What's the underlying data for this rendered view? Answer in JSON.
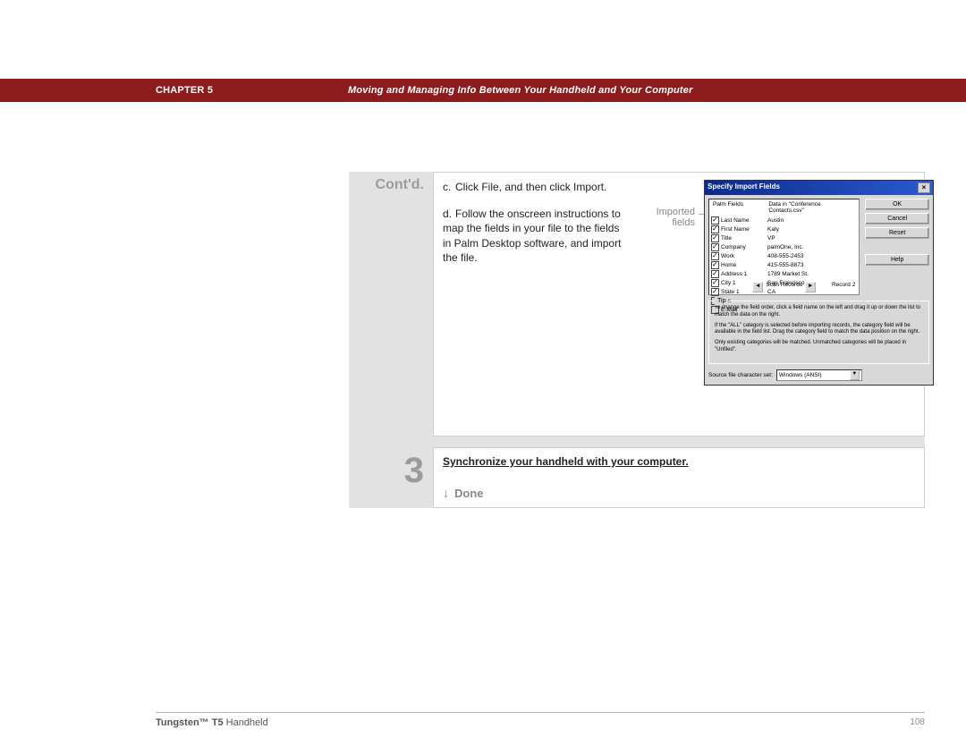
{
  "banner": {
    "chapter": "CHAPTER 5",
    "title": "Moving and Managing Info Between Your Handheld and Your Computer"
  },
  "contd_label": "Cont'd.",
  "steps": {
    "c": {
      "letter": "c.",
      "text": "Click File, and then click Import."
    },
    "d": {
      "letter": "d.",
      "text": "Follow the onscreen instructions to map the fields in your file to the fields in Palm Desktop software, and import the file."
    }
  },
  "callout_label": "Imported fields",
  "dialog": {
    "title": "Specify Import Fields",
    "header_left": "Palm Fields",
    "header_right": "Data in \"Conference Contacts.csv\"",
    "fields": [
      {
        "checked": true,
        "name": "Last Name",
        "value": "Austin"
      },
      {
        "checked": true,
        "name": "First Name",
        "value": "Katy"
      },
      {
        "checked": true,
        "name": "Title",
        "value": "VP"
      },
      {
        "checked": true,
        "name": "Company",
        "value": "palmOne, Inc."
      },
      {
        "checked": true,
        "name": "Work",
        "value": "408-555-2453"
      },
      {
        "checked": true,
        "name": "Home",
        "value": "415-555-8873"
      },
      {
        "checked": true,
        "name": "Address 1",
        "value": "1789 Market St."
      },
      {
        "checked": true,
        "name": "City 1",
        "value": "San Francisco"
      },
      {
        "checked": true,
        "name": "State 1",
        "value": "CA"
      },
      {
        "checked": false,
        "name": "Fax",
        "value": ""
      },
      {
        "checked": false,
        "name": "E-Mail",
        "value": ""
      }
    ],
    "scan_label": "Scan Records",
    "record_label": "Record 2",
    "buttons": {
      "ok": "OK",
      "cancel": "Cancel",
      "reset": "Reset",
      "help": "Help"
    },
    "tip_label": "Tip",
    "tip1": "To change the field order, click a field name on the left and drag it up or down the list to match the data on the right.",
    "tip2": "If the \"ALL\" category is selected before importing records, the category field will be available in the field list. Drag the category field to match the data position on the right.",
    "tip3": "Only existing categories will be matched. Unmatched categories will be placed in \"Unfiled\".",
    "src_label": "Source file character set:",
    "src_value": "Windows (ANSI)"
  },
  "step3": {
    "num": "3",
    "link": "Synchronize your handheld with your computer.",
    "done": "Done"
  },
  "footer": {
    "product_bold": "Tungsten™ T5",
    "product_rest": " Handheld",
    "page": "108"
  }
}
